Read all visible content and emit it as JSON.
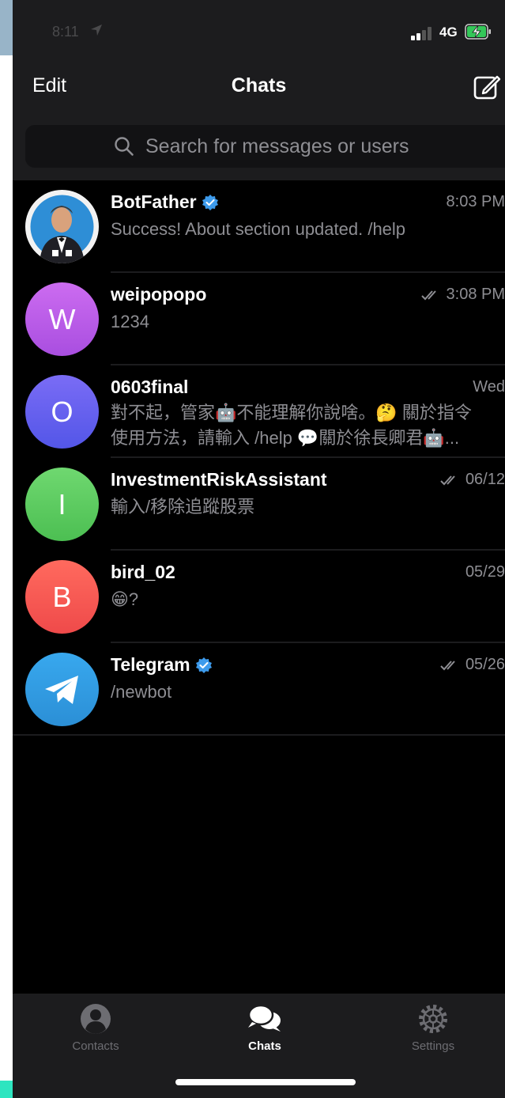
{
  "status_bar": {
    "time": "8:11",
    "network": "4G"
  },
  "nav": {
    "edit_label": "Edit",
    "title": "Chats"
  },
  "search": {
    "placeholder": "Search for messages or users"
  },
  "chats": [
    {
      "name": "BotFather",
      "verified": true,
      "time": "8:03 PM",
      "read_ticks": false,
      "preview_lines": [
        "Success! About section updated. /help"
      ],
      "avatar": "botfather-photo"
    },
    {
      "name": "weipopopo",
      "verified": false,
      "time": "3:08 PM",
      "read_ticks": true,
      "preview_lines": [
        "1234"
      ],
      "avatar_letter": "W",
      "avatar_colors": [
        "#cc6cf0",
        "#a94ee0"
      ]
    },
    {
      "name": "0603final",
      "verified": false,
      "time": "Wed",
      "read_ticks": false,
      "preview_lines": [
        "對不起，管家🤖不能理解你說啥。🤔 關於指令",
        "使用方法，請輸入 /help 💬關於徐長卿君🤖..."
      ],
      "avatar_letter": "O",
      "avatar_colors": [
        "#7a6cf5",
        "#5356e8"
      ]
    },
    {
      "name": "InvestmentRiskAssistant",
      "verified": false,
      "time": "06/12",
      "read_ticks": true,
      "preview_lines": [
        "輸入/移除追蹤股票"
      ],
      "avatar_letter": "I",
      "avatar_colors": [
        "#6fd870",
        "#4cbf52"
      ]
    },
    {
      "name": "bird_02",
      "verified": false,
      "time": "05/29",
      "read_ticks": false,
      "preview_lines": [
        "😁?"
      ],
      "avatar_letter": "B",
      "avatar_colors": [
        "#ff6a5e",
        "#ef4a4a"
      ]
    },
    {
      "name": "Telegram",
      "verified": true,
      "time": "05/26",
      "read_ticks": true,
      "preview_lines": [
        "/newbot"
      ],
      "avatar": "telegram-logo",
      "avatar_colors": [
        "#38a8ee",
        "#2b8fd6"
      ]
    }
  ],
  "tabs": [
    {
      "label": "Contacts",
      "icon": "person-circle-icon",
      "active": false
    },
    {
      "label": "Chats",
      "icon": "chat-bubbles-icon",
      "active": true
    },
    {
      "label": "Settings",
      "icon": "gear-icon",
      "active": false
    }
  ],
  "colors": {
    "accent": "#3d9bec",
    "background": "#000000",
    "header": "#1c1c1e",
    "secondary_text": "#8e8e93",
    "battery_charging": "#34c759"
  }
}
